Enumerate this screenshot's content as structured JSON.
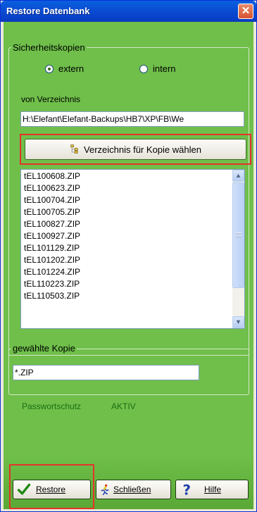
{
  "window": {
    "title": "Restore Datenbank",
    "close_glyph": "✕"
  },
  "backup_group": {
    "legend": "Sicherheitskopien"
  },
  "radio_options": [
    {
      "label": "extern",
      "checked": true
    },
    {
      "label": "intern",
      "checked": false
    }
  ],
  "directory": {
    "label": "von Verzeichnis",
    "path": "H:\\Elefant\\Elefant-Backups\\HB7\\XP\\FB\\We",
    "choose_button": "Verzeichnis für Kopie wählen",
    "choose_icon": "folder-tree-icon"
  },
  "file_list": [
    "tEL100608.ZIP",
    "tEL100623.ZIP",
    "tEL100704.ZIP",
    "tEL100705.ZIP",
    "tEL100827.ZIP",
    "tEL100927.ZIP",
    "tEL101129.ZIP",
    "tEL101202.ZIP",
    "tEL101224.ZIP",
    "tEL110223.ZIP",
    "tEL110503.ZIP"
  ],
  "selected_copy": {
    "legend": "gewählte Kopie",
    "value": "*.ZIP"
  },
  "status": {
    "label": "Passwortschutz",
    "value": "AKTIV"
  },
  "buttons": {
    "restore": {
      "label": "Restore",
      "icon": "checkmark-icon"
    },
    "close": {
      "label": "Schließen",
      "icon": "running-person-icon"
    },
    "help": {
      "label": "Hilfe",
      "icon": "question-mark-icon"
    }
  },
  "colors": {
    "client_bg": "#6fbf4a",
    "status_text": "#1d6e13",
    "highlight_frame": "#e4342a"
  }
}
